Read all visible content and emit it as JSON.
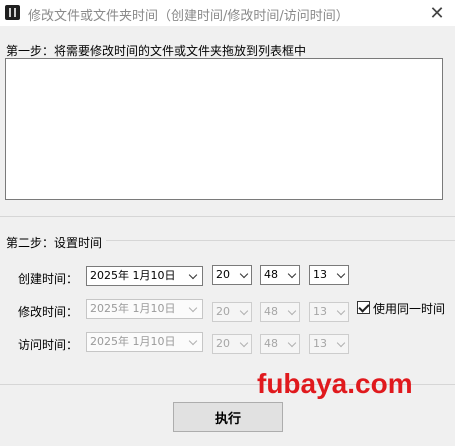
{
  "window": {
    "title": "修改文件或文件夹时间（创建时间/修改时间/访问时间）",
    "close_glyph": "✕",
    "icon": "app-icon"
  },
  "step1": {
    "label": "第一步：将需要修改时间的文件或文件夹拖放到列表框中"
  },
  "step2": {
    "label": "第二步：设置时间"
  },
  "rows": [
    {
      "label": "创建时间：",
      "date": "2025年 1月10日",
      "hour": "20",
      "minute": "48",
      "second": "13",
      "enabled": true
    },
    {
      "label": "修改时间：",
      "date": "2025年 1月10日",
      "hour": "20",
      "minute": "48",
      "second": "13",
      "enabled": false
    },
    {
      "label": "访问时间：",
      "date": "2025年 1月10日",
      "hour": "20",
      "minute": "48",
      "second": "13",
      "enabled": false
    }
  ],
  "same_time": {
    "label": "使用同一时间",
    "checked": true
  },
  "execute_label": "执行",
  "watermark": "fubaya.com",
  "colors": {
    "watermark": "#e0191d",
    "background": "#f0f0f0"
  }
}
